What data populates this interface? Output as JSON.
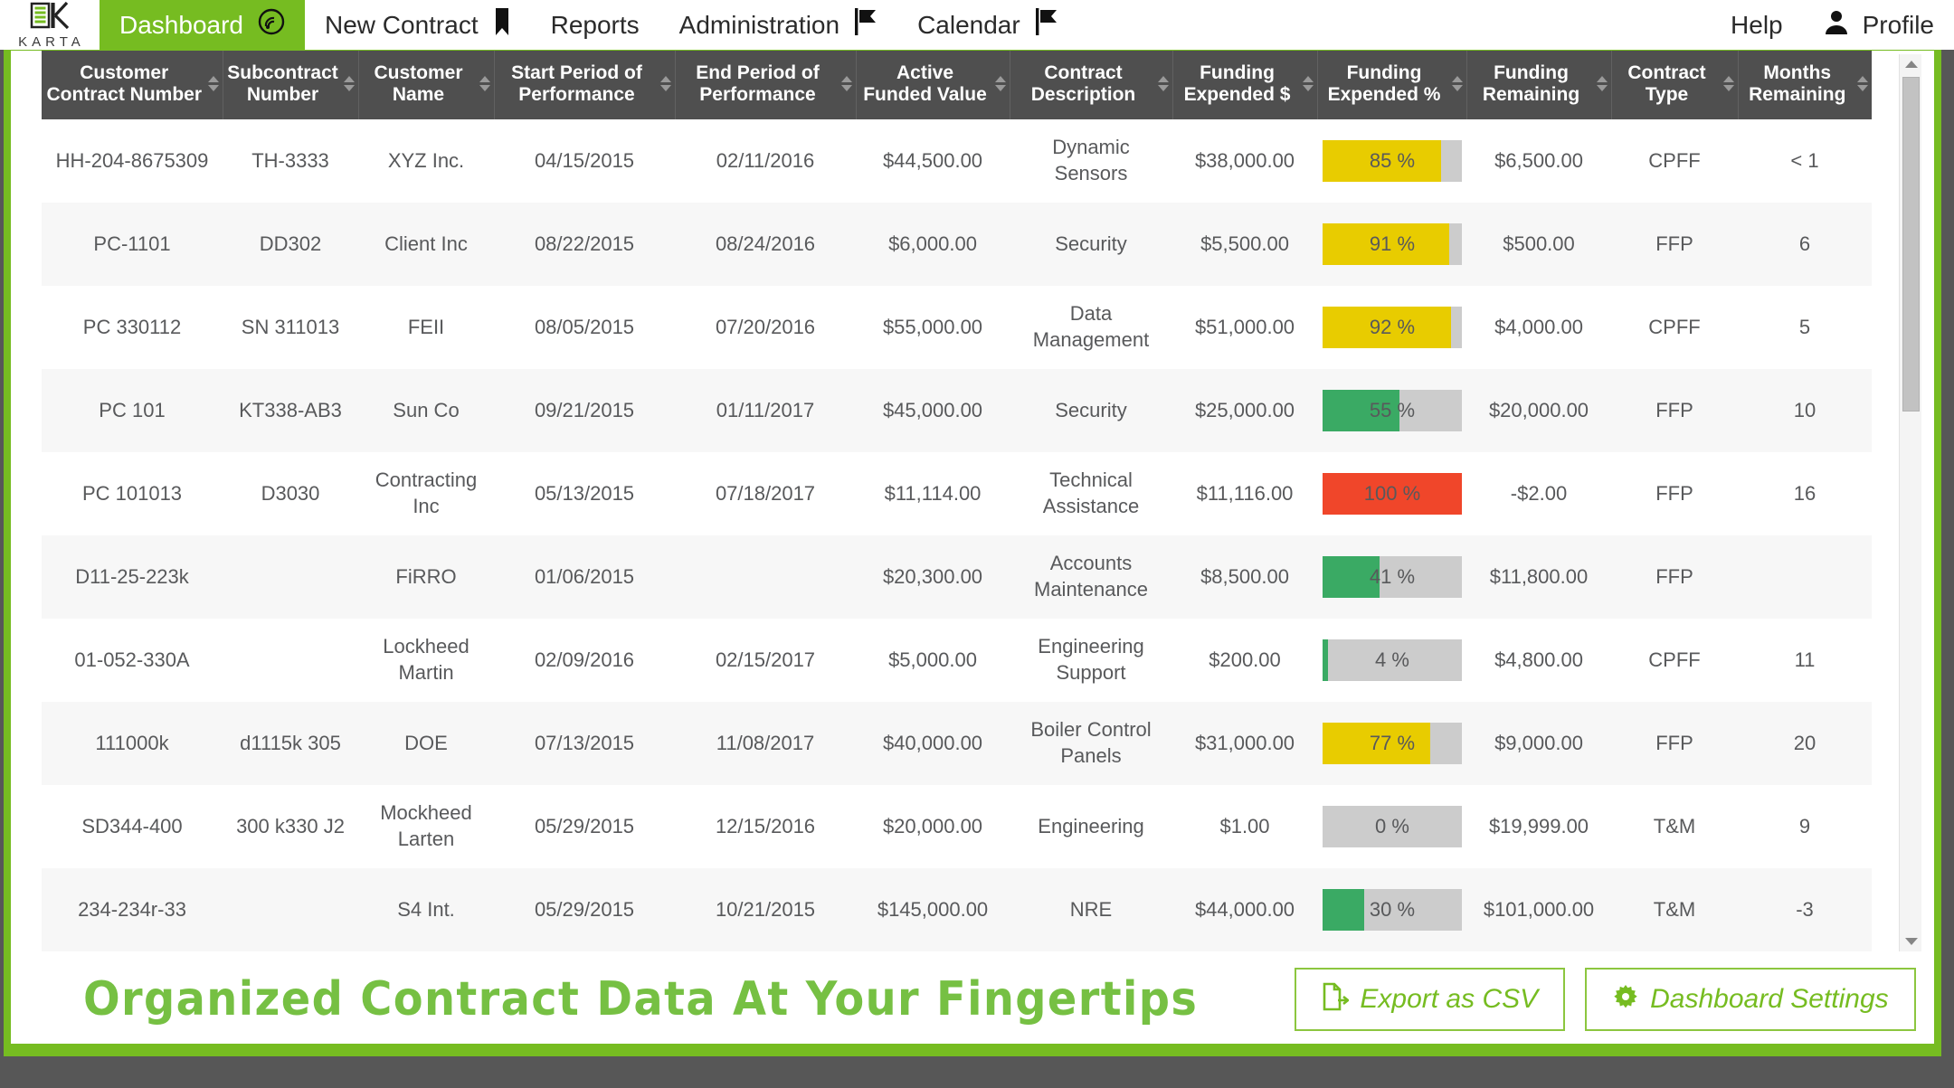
{
  "brand": {
    "word": "KARTA",
    "logo_icon": "karta-logo-icon",
    "accent": "#76bc21"
  },
  "nav": {
    "items": [
      {
        "label": "Dashboard",
        "icon": "radar-icon",
        "active": true
      },
      {
        "label": "New Contract",
        "icon": "bookmark-icon",
        "active": false
      },
      {
        "label": "Reports",
        "icon": "",
        "active": false
      },
      {
        "label": "Administration",
        "icon": "flag-icon",
        "active": false
      },
      {
        "label": "Calendar",
        "icon": "flag-icon",
        "active": false
      }
    ],
    "right": [
      {
        "label": "Help",
        "icon": ""
      },
      {
        "label": "Profile",
        "icon": "user-icon"
      }
    ]
  },
  "table": {
    "columns": [
      "Customer Contract Number",
      "Subcontract Number",
      "Customer Name",
      "Start Period of Performance",
      "End Period of Performance",
      "Active Funded Value",
      "Contract Description",
      "Funding Expended $",
      "Funding Expended %",
      "Funding Remaining",
      "Contract Type",
      "Months Remaining"
    ],
    "rows": [
      {
        "customer_contract_number": "HH-204-8675309",
        "subcontract_number": "TH-3333",
        "customer_name": "XYZ Inc.",
        "start_pop": "04/15/2015",
        "end_pop": "02/11/2016",
        "active_funded_value": "$44,500.00",
        "contract_description": "Dynamic Sensors",
        "funding_expended_dollars": "$38,000.00",
        "funding_expended_pct_label": "85 %",
        "funding_expended_pct": 85,
        "bar_color": "#e8cc00",
        "funding_remaining": "$6,500.00",
        "contract_type": "CPFF",
        "months_remaining": "< 1"
      },
      {
        "customer_contract_number": "PC-1101",
        "subcontract_number": "DD302",
        "customer_name": "Client Inc",
        "start_pop": "08/22/2015",
        "end_pop": "08/24/2016",
        "active_funded_value": "$6,000.00",
        "contract_description": "Security",
        "funding_expended_dollars": "$5,500.00",
        "funding_expended_pct_label": "91 %",
        "funding_expended_pct": 91,
        "bar_color": "#e8cc00",
        "funding_remaining": "$500.00",
        "contract_type": "FFP",
        "months_remaining": "6"
      },
      {
        "customer_contract_number": "PC 330112",
        "subcontract_number": "SN 311013",
        "customer_name": "FEII",
        "start_pop": "08/05/2015",
        "end_pop": "07/20/2016",
        "active_funded_value": "$55,000.00",
        "contract_description": "Data Management",
        "funding_expended_dollars": "$51,000.00",
        "funding_expended_pct_label": "92 %",
        "funding_expended_pct": 92,
        "bar_color": "#e8cc00",
        "funding_remaining": "$4,000.00",
        "contract_type": "CPFF",
        "months_remaining": "5"
      },
      {
        "customer_contract_number": "PC 101",
        "subcontract_number": "KT338-AB3",
        "customer_name": "Sun Co",
        "start_pop": "09/21/2015",
        "end_pop": "01/11/2017",
        "active_funded_value": "$45,000.00",
        "contract_description": "Security",
        "funding_expended_dollars": "$25,000.00",
        "funding_expended_pct_label": "55 %",
        "funding_expended_pct": 55,
        "bar_color": "#3aaa64",
        "funding_remaining": "$20,000.00",
        "contract_type": "FFP",
        "months_remaining": "10"
      },
      {
        "customer_contract_number": "PC 101013",
        "subcontract_number": "D3030",
        "customer_name": "Contracting Inc",
        "start_pop": "05/13/2015",
        "end_pop": "07/18/2017",
        "active_funded_value": "$11,114.00",
        "contract_description": "Technical Assistance",
        "funding_expended_dollars": "$11,116.00",
        "funding_expended_pct_label": "100 %",
        "funding_expended_pct": 100,
        "bar_color": "#f0462a",
        "funding_remaining": "-$2.00",
        "contract_type": "FFP",
        "months_remaining": "16"
      },
      {
        "customer_contract_number": "D11-25-223k",
        "subcontract_number": "",
        "customer_name": "FiRRO",
        "start_pop": "01/06/2015",
        "end_pop": "",
        "active_funded_value": "$20,300.00",
        "contract_description": "Accounts Maintenance",
        "funding_expended_dollars": "$8,500.00",
        "funding_expended_pct_label": "41 %",
        "funding_expended_pct": 41,
        "bar_color": "#3aaa64",
        "funding_remaining": "$11,800.00",
        "contract_type": "FFP",
        "months_remaining": ""
      },
      {
        "customer_contract_number": "01-052-330A",
        "subcontract_number": "",
        "customer_name": "Lockheed Martin",
        "start_pop": "02/09/2016",
        "end_pop": "02/15/2017",
        "active_funded_value": "$5,000.00",
        "contract_description": "Engineering Support",
        "funding_expended_dollars": "$200.00",
        "funding_expended_pct_label": "4 %",
        "funding_expended_pct": 4,
        "bar_color": "#3aaa64",
        "funding_remaining": "$4,800.00",
        "contract_type": "CPFF",
        "months_remaining": "11"
      },
      {
        "customer_contract_number": "111000k",
        "subcontract_number": "d1115k 305",
        "customer_name": "DOE",
        "start_pop": "07/13/2015",
        "end_pop": "11/08/2017",
        "active_funded_value": "$40,000.00",
        "contract_description": "Boiler Control Panels",
        "funding_expended_dollars": "$31,000.00",
        "funding_expended_pct_label": "77 %",
        "funding_expended_pct": 77,
        "bar_color": "#e8cc00",
        "funding_remaining": "$9,000.00",
        "contract_type": "FFP",
        "months_remaining": "20"
      },
      {
        "customer_contract_number": "SD344-400",
        "subcontract_number": "300 k330 J2",
        "customer_name": "Mockheed Larten",
        "start_pop": "05/29/2015",
        "end_pop": "12/15/2016",
        "active_funded_value": "$20,000.00",
        "contract_description": "Engineering",
        "funding_expended_dollars": "$1.00",
        "funding_expended_pct_label": "0 %",
        "funding_expended_pct": 0,
        "bar_color": "#3aaa64",
        "funding_remaining": "$19,999.00",
        "contract_type": "T&M",
        "months_remaining": "9"
      },
      {
        "customer_contract_number": "234-234r-33",
        "subcontract_number": "",
        "customer_name": "S4 Int.",
        "start_pop": "05/29/2015",
        "end_pop": "10/21/2015",
        "active_funded_value": "$145,000.00",
        "contract_description": "NRE",
        "funding_expended_dollars": "$44,000.00",
        "funding_expended_pct_label": "30 %",
        "funding_expended_pct": 30,
        "bar_color": "#3aaa64",
        "funding_remaining": "$101,000.00",
        "contract_type": "T&M",
        "months_remaining": "-3"
      }
    ]
  },
  "footer": {
    "tagline": "Organized Contract Data At Your Fingertips",
    "buttons": [
      {
        "label": "Export as CSV",
        "icon": "file-export-icon"
      },
      {
        "label": "Dashboard Settings",
        "icon": "gear-icon"
      }
    ]
  },
  "scrollbar": {
    "up_icon": "caret-up-icon",
    "down_icon": "caret-down-icon"
  }
}
